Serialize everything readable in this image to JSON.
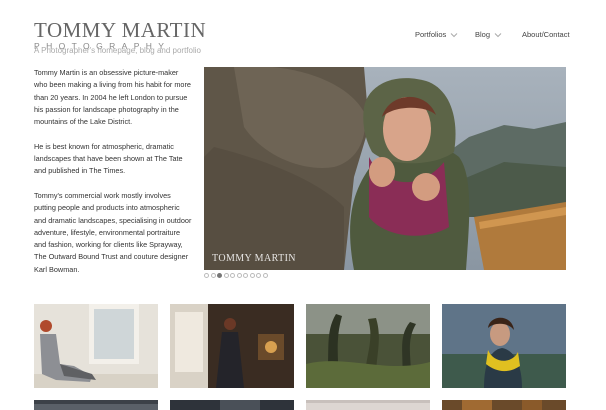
{
  "site": {
    "logo_name": "Tommy Martin",
    "logo_sub": "Photography",
    "tagline": "A Photographer's homepage, blog and portfolio"
  },
  "nav": {
    "items": [
      {
        "label": "Portfolios",
        "has_dropdown": true
      },
      {
        "label": "Blog",
        "has_dropdown": true
      },
      {
        "label": "About/Contact",
        "has_dropdown": false
      }
    ]
  },
  "intro": {
    "paragraphs": [
      "Tommy Martin is an obsessive picture-maker who been making a living from his habit for more than 20 years. In 2004 he left London to pursue his passion for landscape photography in the mountains of the Lake District.",
      "He is best known for atmospheric, dramatic landscapes that have been shown at The Tate and published in The Times.",
      "Tommy's commercial work mostly involves putting people and products into atmospheric and dramatic landscapes, specialising in outdoor adventure, lifestyle, environmental portraiture and fashion, working for clients like Sprayway, The Outward Bound Trust and couture designer Karl Bowman."
    ]
  },
  "slider": {
    "watermark": "Tommy Martin",
    "dot_count": 10,
    "active_dot": 2
  },
  "colors": {
    "text": "#333333",
    "muted": "#aaaaaa",
    "dot_active": "#777777"
  }
}
